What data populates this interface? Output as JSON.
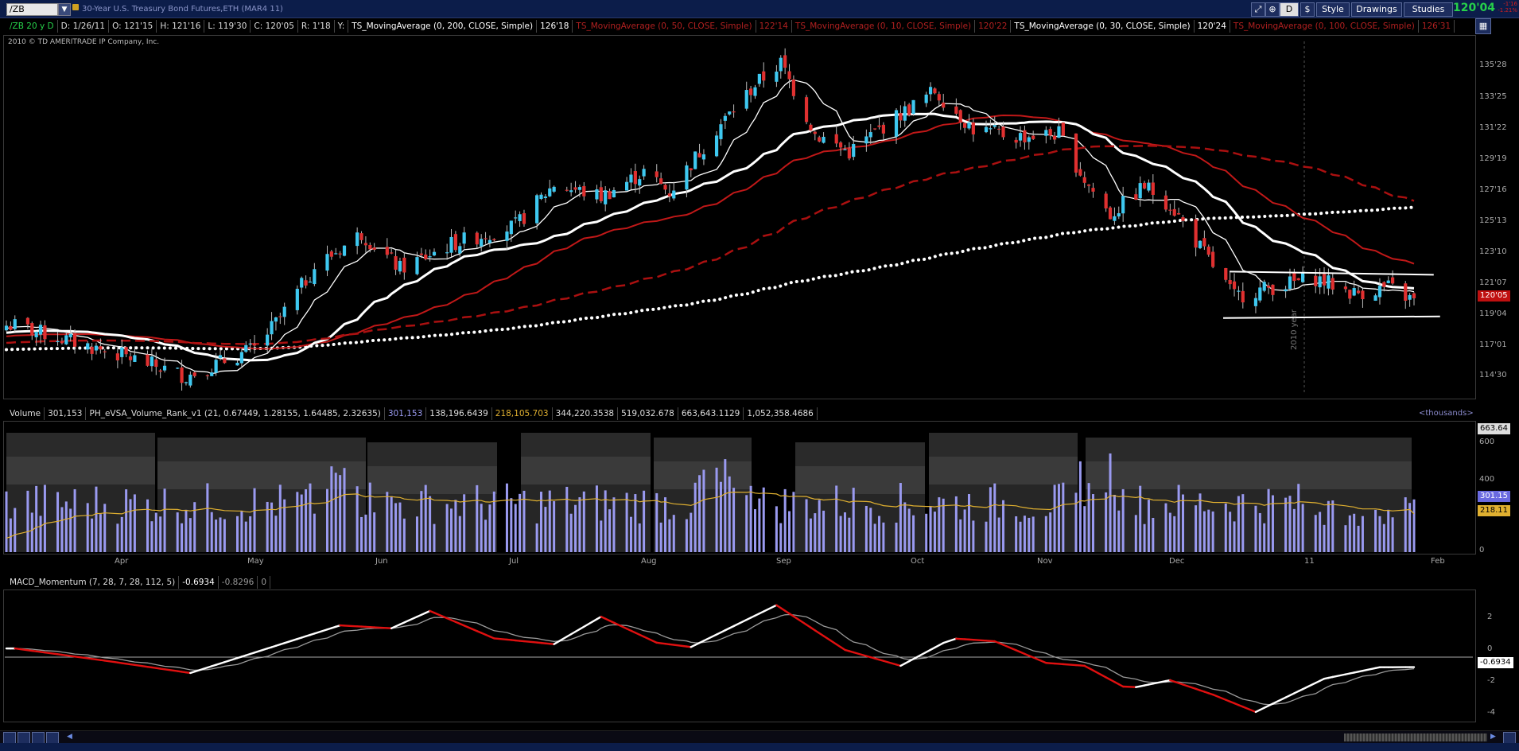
{
  "window": {
    "symbol": "/ZB",
    "instrument_title": "30-Year U.S. Treasury Bond Futures,ETH (MAR4 11)",
    "last_price": "120'04",
    "net_change_up": "-1'16",
    "net_change_down": "-1.21%",
    "style_label": "Style",
    "drawings_label": "Drawings",
    "studies_label": "Studies",
    "period_label": "D"
  },
  "info": {
    "aggregation": "/ZB 20 y D",
    "date": "D: 1/26/11",
    "open": "O: 121'15",
    "high": "H: 121'16",
    "low": "L: 119'30",
    "close": "C: 120'05",
    "range": "R: 1'18",
    "y": "Y:",
    "ma200_label": "TS_MovingAverage (0, 200, CLOSE, Simple)",
    "ma200_value": "126'18",
    "ma50_label": "TS_MovingAverage (0, 50, CLOSE, Simple)",
    "ma50_value": "122'14",
    "ma10_label": "TS_MovingAverage (0, 10, CLOSE, Simple)",
    "ma10_value": "120'22",
    "ma30_label": "TS_MovingAverage (0, 30, CLOSE, Simple)",
    "ma30_value": "120'24",
    "ma100_label": "TS_MovingAverage (0, 100, CLOSE, Simple)",
    "ma100_value": "126'31"
  },
  "copyright": "2010 © TD AMERITRADE IP Company, Inc.",
  "price_axis": [
    "135'28",
    "133'25",
    "131'22",
    "129'19",
    "127'16",
    "125'13",
    "123'10",
    "121'07",
    "119'04",
    "117'01",
    "114'30"
  ],
  "current_price_tag": "120'05",
  "year_marker": "2010 year",
  "volume_legend": {
    "label": "Volume",
    "volume": "301,153",
    "study": "PH_eVSA_Volume_Rank_v1 (21, 0.67449, 1.28155, 1.64485, 2.32635)",
    "v1": "301,153",
    "v2": "138,196.6439",
    "v3": "218,105.703",
    "v4": "344,220.3538",
    "v5": "519,032.678",
    "v6": "663,643.1129",
    "v7": "1,052,358.4686",
    "units": "<thousands>"
  },
  "volume_axis": [
    "600",
    "400",
    "200",
    "0"
  ],
  "volume_tags": {
    "top": "663.64",
    "volume": "301.15",
    "average": "218.11"
  },
  "months": [
    "Apr",
    "May",
    "Jun",
    "Jul",
    "Aug",
    "Sep",
    "Oct",
    "Nov",
    "Dec",
    "11",
    "Feb"
  ],
  "macd_legend": {
    "label": "MACD_Momentum (7, 28, 7, 28, 112, 5)",
    "v1": "-0.6934",
    "v2": "-0.8296",
    "v3": "0"
  },
  "macd_axis": [
    "2",
    "0",
    "-2",
    "-4"
  ],
  "macd_tag": "-0.6934",
  "colors": {
    "up": "#3ec8f0",
    "down": "#e03030",
    "volume_bar": "#9a9af0",
    "volume_avg": "#e0b030",
    "title_bg": "#0c1d4a",
    "macd_up": "#ffffff",
    "macd_down": "#e01010",
    "macd_signal": "#999999"
  },
  "chart_data": {
    "type": "candlestick",
    "x_range": [
      "2010-03",
      "2011-02"
    ],
    "ylim": [
      114,
      136.5
    ],
    "price_anchors": [
      {
        "date": "2010-03-05",
        "close": 118.5
      },
      {
        "date": "2010-04-01",
        "close": 116.4
      },
      {
        "date": "2010-04-14",
        "close": 115.2
      },
      {
        "date": "2010-04-30",
        "close": 117.0
      },
      {
        "date": "2010-05-06",
        "close": 119.0
      },
      {
        "date": "2010-05-14",
        "close": 122.3
      },
      {
        "date": "2010-05-25",
        "close": 124.5
      },
      {
        "date": "2010-06-03",
        "close": 122.2
      },
      {
        "date": "2010-06-15",
        "close": 123.8
      },
      {
        "date": "2010-06-30",
        "close": 125.0
      },
      {
        "date": "2010-07-09",
        "close": 127.7
      },
      {
        "date": "2010-07-20",
        "close": 126.9
      },
      {
        "date": "2010-07-30",
        "close": 128.5
      },
      {
        "date": "2010-08-05",
        "close": 127.2
      },
      {
        "date": "2010-08-16",
        "close": 131.3
      },
      {
        "date": "2010-08-25",
        "close": 134.2
      },
      {
        "date": "2010-08-31",
        "close": 135.6
      },
      {
        "date": "2010-09-08",
        "close": 131.0
      },
      {
        "date": "2010-09-16",
        "close": 129.8
      },
      {
        "date": "2010-09-24",
        "close": 131.5
      },
      {
        "date": "2010-10-06",
        "close": 133.8
      },
      {
        "date": "2010-10-15",
        "close": 131.3
      },
      {
        "date": "2010-10-25",
        "close": 130.8
      },
      {
        "date": "2010-11-04",
        "close": 131.0
      },
      {
        "date": "2010-11-10",
        "close": 128.0
      },
      {
        "date": "2010-11-16",
        "close": 125.7
      },
      {
        "date": "2010-11-24",
        "close": 127.6
      },
      {
        "date": "2010-11-30",
        "close": 126.4
      },
      {
        "date": "2010-12-07",
        "close": 123.6
      },
      {
        "date": "2010-12-15",
        "close": 120.4
      },
      {
        "date": "2010-12-22",
        "close": 120.9
      },
      {
        "date": "2011-01-03",
        "close": 121.6
      },
      {
        "date": "2011-01-12",
        "close": 120.6
      },
      {
        "date": "2011-01-20",
        "close": 121.0
      },
      {
        "date": "2011-01-26",
        "close": 120.1
      }
    ],
    "moving_averages": [
      {
        "name": "TS_MovingAverage (0, 200, CLOSE, Simple)",
        "last": 126.56,
        "style": "dotted-thick-white"
      },
      {
        "name": "TS_MovingAverage (0, 50, CLOSE, Simple)",
        "last": 122.44,
        "style": "solid-red"
      },
      {
        "name": "TS_MovingAverage (0, 10, CLOSE, Simple)",
        "last": 120.69,
        "style": "solid-thin-white"
      },
      {
        "name": "TS_MovingAverage (0, 30, CLOSE, Simple)",
        "last": 120.75,
        "style": "solid-thick-white"
      },
      {
        "name": "TS_MovingAverage (0, 100, CLOSE, Simple)",
        "last": 126.97,
        "style": "dashed"
      }
    ],
    "channel": {
      "upper": 121.6,
      "lower": 119.2,
      "start": "2010-12-15",
      "end": "2011-01-28"
    },
    "volume_ylim": [
      0,
      700
    ],
    "volume_last": 301.15,
    "volume_average_last": 218.11,
    "macd_ylim": [
      -4.3,
      4.3
    ],
    "macd_last": -0.6934,
    "macd_signal_last": -0.8296,
    "macd_anchors": [
      {
        "date": "2010-03-05",
        "v": 0.6
      },
      {
        "date": "2010-03-25",
        "v": -0.2
      },
      {
        "date": "2010-04-15",
        "v": -1.1
      },
      {
        "date": "2010-05-20",
        "v": 2.2
      },
      {
        "date": "2010-06-01",
        "v": 2.0
      },
      {
        "date": "2010-06-10",
        "v": 3.2
      },
      {
        "date": "2010-06-25",
        "v": 1.3
      },
      {
        "date": "2010-07-09",
        "v": 0.9
      },
      {
        "date": "2010-07-20",
        "v": 2.8
      },
      {
        "date": "2010-08-02",
        "v": 1.0
      },
      {
        "date": "2010-08-10",
        "v": 0.7
      },
      {
        "date": "2010-08-30",
        "v": 3.6
      },
      {
        "date": "2010-09-15",
        "v": 0.5
      },
      {
        "date": "2010-09-28",
        "v": -0.6
      },
      {
        "date": "2010-10-10",
        "v": 1.3
      },
      {
        "date": "2010-10-20",
        "v": 1.1
      },
      {
        "date": "2010-11-01",
        "v": -0.4
      },
      {
        "date": "2010-11-10",
        "v": -0.6
      },
      {
        "date": "2010-11-20",
        "v": -2.2
      },
      {
        "date": "2010-11-30",
        "v": -1.6
      },
      {
        "date": "2010-12-10",
        "v": -2.6
      },
      {
        "date": "2010-12-20",
        "v": -3.8
      },
      {
        "date": "2011-01-05",
        "v": -1.5
      },
      {
        "date": "2011-01-18",
        "v": -0.7
      },
      {
        "date": "2011-01-26",
        "v": -0.6934
      }
    ]
  }
}
